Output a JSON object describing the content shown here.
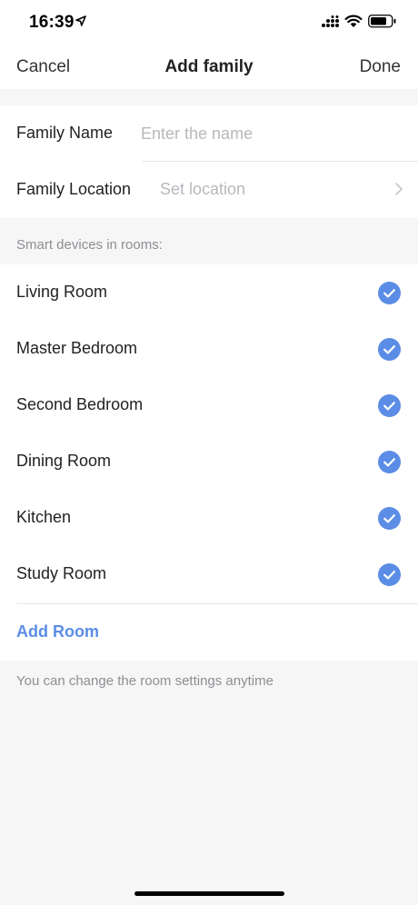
{
  "status_bar": {
    "time": "16:39",
    "icons": [
      "location-arrow-icon",
      "signal-icon",
      "wifi-icon",
      "battery-icon"
    ]
  },
  "nav": {
    "cancel": "Cancel",
    "title": "Add family",
    "done": "Done"
  },
  "form": {
    "name_label": "Family Name",
    "name_placeholder": "Enter the name",
    "name_value": "",
    "location_label": "Family Location",
    "location_value": "Set location"
  },
  "rooms": {
    "header": "Smart devices in rooms:",
    "items": [
      {
        "name": "Living Room",
        "checked": true
      },
      {
        "name": "Master Bedroom",
        "checked": true
      },
      {
        "name": "Second Bedroom",
        "checked": true
      },
      {
        "name": "Dining Room",
        "checked": true
      },
      {
        "name": "Kitchen",
        "checked": true
      },
      {
        "name": "Study Room",
        "checked": true
      }
    ],
    "add_room": "Add Room",
    "note": "You can change the room settings anytime"
  },
  "colors": {
    "accent": "#5b8de6",
    "background": "#f6f6f7",
    "card": "#ffffff",
    "placeholder": "#b8b8bd",
    "secondary_text": "#8e8e93"
  }
}
